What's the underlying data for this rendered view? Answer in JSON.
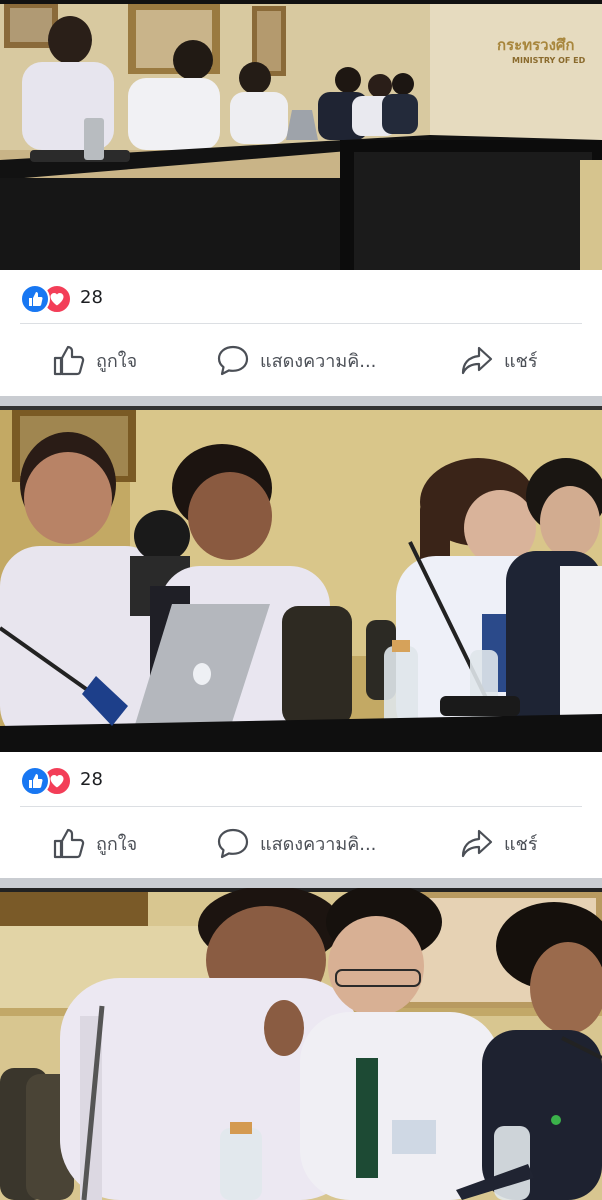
{
  "posts": [
    {
      "photo_alt": "",
      "reaction_count": "28",
      "actions": {
        "like": "ถูกใจ",
        "comment": "แสดงความคิ...",
        "share": "แชร์"
      }
    },
    {
      "photo_alt": "",
      "reaction_count": "28",
      "actions": {
        "like": "ถูกใจ",
        "comment": "แสดงความคิ...",
        "share": "แชร์"
      }
    },
    {
      "photo_alt": ""
    }
  ],
  "wall_sign": {
    "thai": "กระทรวงศึก",
    "english": "MINISTRY OF ED"
  },
  "colors": {
    "like_blue": "#1877f2",
    "love_red": "#f33e58",
    "action_gray": "#4b4f56",
    "separator": "#c9ccd1"
  },
  "icons": [
    "like-reaction-icon",
    "love-reaction-icon",
    "thumbs-up-icon",
    "comment-icon",
    "share-icon"
  ]
}
